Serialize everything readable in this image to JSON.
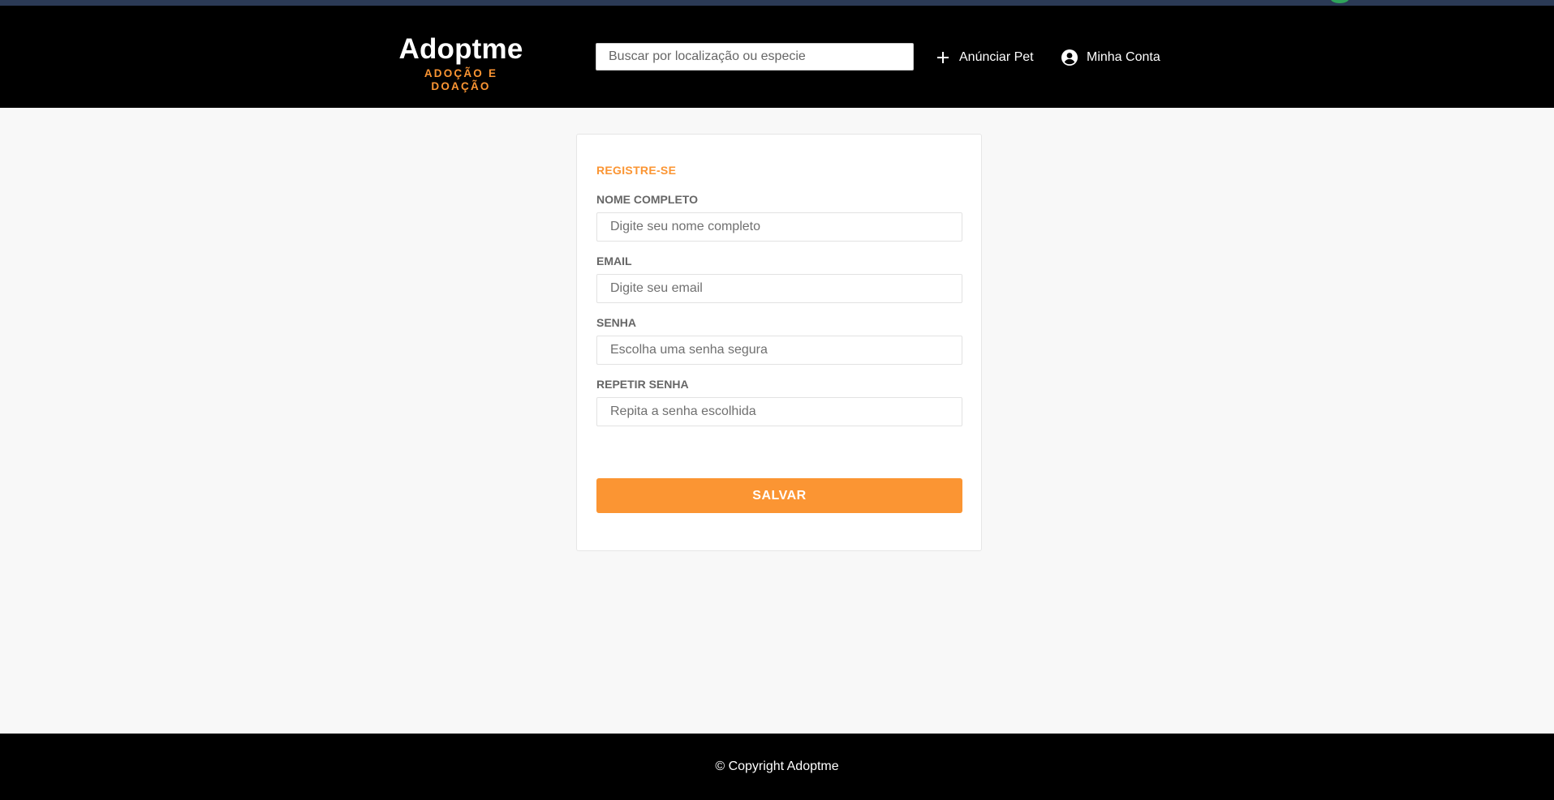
{
  "header": {
    "brand_title": "Adoptme",
    "brand_subtitle": "ADOÇÃO E DOAÇÃO",
    "search_placeholder": "Buscar por localização ou especie",
    "nav": {
      "anunciar_label": "Anúnciar Pet",
      "anunciar_icon": "plus-icon",
      "conta_label": "Minha Conta",
      "conta_icon": "account-circle-icon"
    }
  },
  "form": {
    "title": "REGISTRE-SE",
    "fields": [
      {
        "label": "NOME COMPLETO",
        "placeholder": "Digite seu nome completo",
        "value": ""
      },
      {
        "label": "EMAIL",
        "placeholder": "Digite seu email",
        "value": ""
      },
      {
        "label": "SENHA",
        "placeholder": "Escolha uma senha segura",
        "value": ""
      },
      {
        "label": "REPETIR SENHA",
        "placeholder": "Repita a senha escolhida",
        "value": ""
      }
    ],
    "submit_label": "SALVAR"
  },
  "footer": {
    "copyright": "© Copyright Adoptme"
  },
  "colors": {
    "accent": "#fb9533",
    "header_bg": "#000000",
    "page_bg": "#f8f8f8"
  }
}
